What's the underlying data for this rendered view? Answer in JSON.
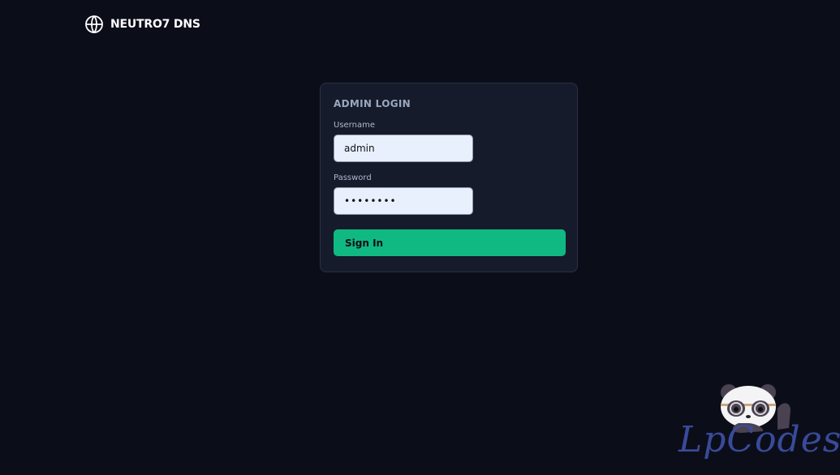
{
  "brand": {
    "name": "NEUTRO7 DNS",
    "icon": "globe-icon"
  },
  "login": {
    "title": "ADMIN LOGIN",
    "username_label": "Username",
    "username_value": "admin",
    "password_label": "Password",
    "password_value": "••••••••",
    "signin_label": "Sign In"
  },
  "watermark": {
    "text": "LpCodes",
    "icon": "panda-mascot"
  },
  "colors": {
    "background": "#0b0e19",
    "card": "#161b2b",
    "accent": "#10b981",
    "input_bg": "#e8f0fe",
    "watermark": "#3a4a9a"
  }
}
